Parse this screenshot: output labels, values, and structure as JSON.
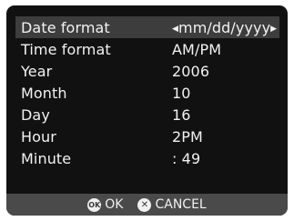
{
  "menu": {
    "items": [
      {
        "label": "Date format",
        "value": "mm/dd/yyyy",
        "left_arrow": "◀",
        "right_arrow": "▶"
      },
      {
        "label": "Time format",
        "value": "AM/PM"
      },
      {
        "label": "Year",
        "value": "2006"
      },
      {
        "label": "Month",
        "value": "10"
      },
      {
        "label": "Day",
        "value": "16"
      },
      {
        "label": "Hour",
        "value": "2PM"
      },
      {
        "label": "Minute",
        "value": ": 49"
      }
    ]
  },
  "footer": {
    "ok_icon_text": "OK",
    "ok_label": "OK",
    "cancel_icon_text": "✕",
    "cancel_label": "CANCEL"
  },
  "colors": {
    "screen_bg": "#111111",
    "selected_row_bg": "#3d3d3d",
    "footer_bg": "#4a4a4a",
    "text": "#f2f2f2"
  },
  "icons": [
    "left-arrow-icon",
    "right-arrow-icon",
    "ok-button-icon",
    "cancel-button-icon"
  ]
}
